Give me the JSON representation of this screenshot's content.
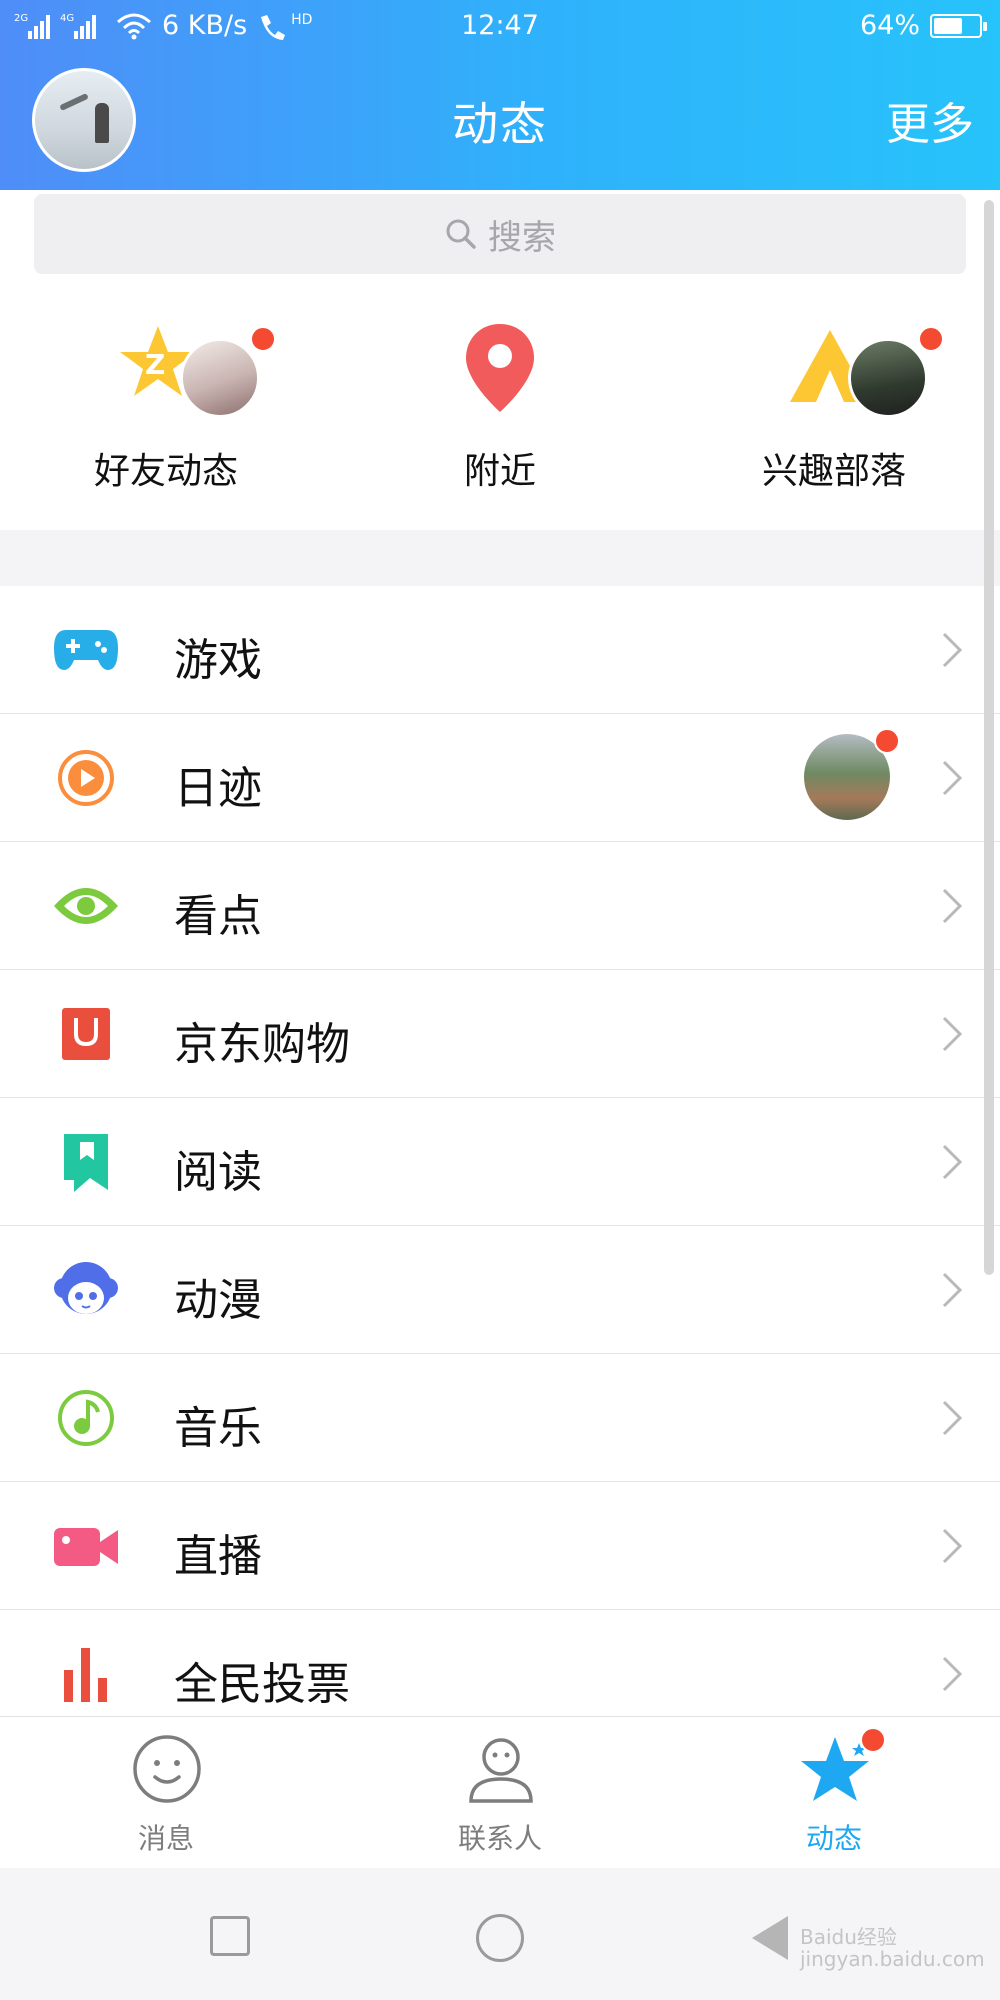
{
  "status_bar": {
    "network": "2G 4G",
    "speed": "6 KB/s",
    "call": "HD",
    "time": "12:47",
    "battery": "64%",
    "battery_level": 0.64
  },
  "header": {
    "title": "动态",
    "more": "更多"
  },
  "search": {
    "placeholder": "搜索"
  },
  "quick_entries": [
    {
      "label": "好友动态",
      "icon": "qzone-star-icon",
      "has_dot": true
    },
    {
      "label": "附近",
      "icon": "location-pin-icon",
      "has_dot": false
    },
    {
      "label": "兴趣部落",
      "icon": "tent-icon",
      "has_dot": true
    }
  ],
  "list": [
    {
      "label": "游戏",
      "icon": "gamepad-icon"
    },
    {
      "label": "日迹",
      "icon": "play-circle-icon",
      "has_thumb": true
    },
    {
      "label": "看点",
      "icon": "eye-icon"
    },
    {
      "label": "京东购物",
      "icon": "shopping-bag-icon"
    },
    {
      "label": "阅读",
      "icon": "bookmark-icon"
    },
    {
      "label": "动漫",
      "icon": "anime-face-icon"
    },
    {
      "label": "音乐",
      "icon": "music-note-icon"
    },
    {
      "label": "直播",
      "icon": "video-camera-icon"
    },
    {
      "label": "全民投票",
      "icon": "bar-chart-icon"
    }
  ],
  "tabs": [
    {
      "label": "消息",
      "icon": "smile-icon",
      "active": false
    },
    {
      "label": "联系人",
      "icon": "person-icon",
      "active": false
    },
    {
      "label": "动态",
      "icon": "star-icon",
      "active": true
    }
  ],
  "watermark": "Baidu经验 jingyan.baidu.com",
  "colors": {
    "header_start": "#4f8df8",
    "header_end": "#27c3fb",
    "active_tab": "#1fa8f2",
    "badge": "#f54a32"
  }
}
